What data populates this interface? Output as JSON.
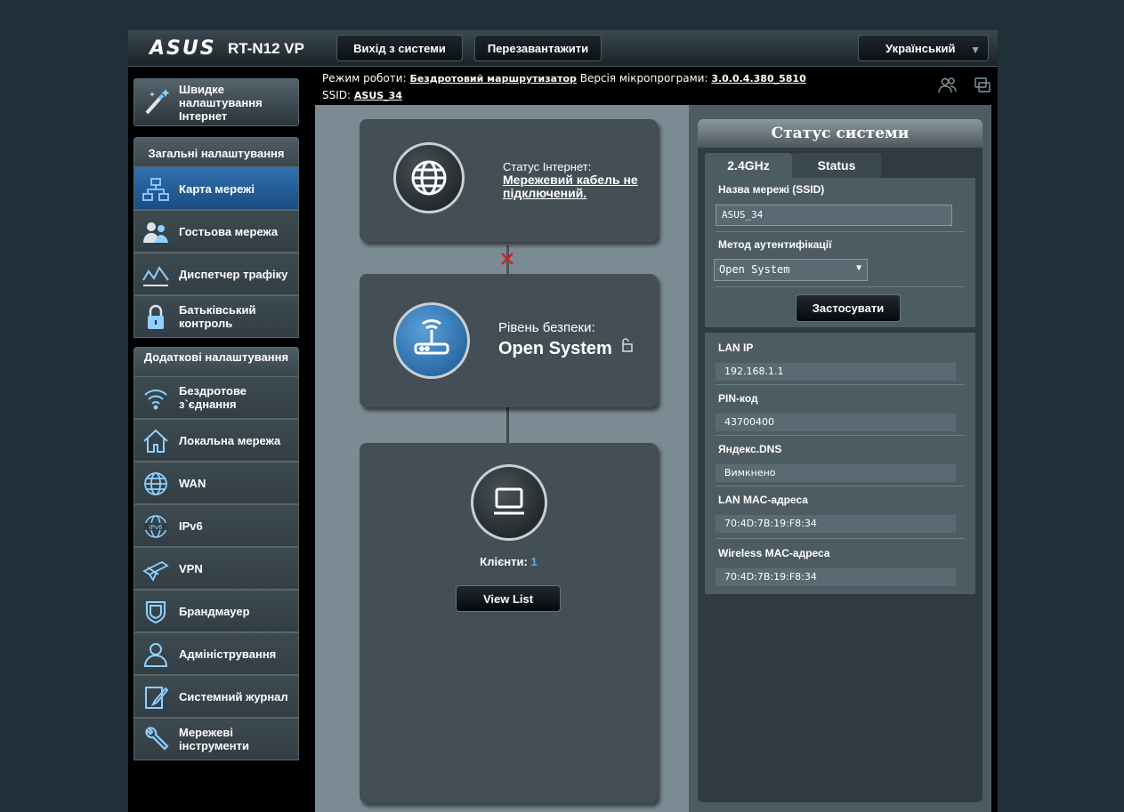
{
  "header": {
    "logo_text": "ASUS",
    "model": "RT-N12 VP",
    "logout_label": "Вихід з системи",
    "reboot_label": "Перезавантажити",
    "language": "Український"
  },
  "info": {
    "mode_label": "Режим роботи:",
    "mode_value": "Бездротовий маршрутизатор",
    "fw_label": "Версія мікропрограми:",
    "fw_value": "3.0.0.4.380_5810",
    "ssid_label": "SSID:",
    "ssid_value": "ASUS_34"
  },
  "sidebar": {
    "quick_setup": "Швидке налаштування Інтернет",
    "general_header": "Загальні налаштування",
    "general_items": [
      {
        "label": "Карта мережі",
        "icon": "network-map-icon",
        "active": true
      },
      {
        "label": "Гостьова мережа",
        "icon": "guest-network-icon"
      },
      {
        "label": "Диспетчер трафіку",
        "icon": "traffic-manager-icon"
      },
      {
        "label": "Батьківський контроль",
        "icon": "parental-lock-icon"
      }
    ],
    "advanced_header": "Додаткові налаштування",
    "advanced_items": [
      {
        "label": "Бездротове з`єднання",
        "icon": "wifi-icon"
      },
      {
        "label": "Локальна мережа",
        "icon": "home-icon"
      },
      {
        "label": "WAN",
        "icon": "globe-icon"
      },
      {
        "label": "IPv6",
        "icon": "ipv6-icon"
      },
      {
        "label": "VPN",
        "icon": "vpn-icon"
      },
      {
        "label": "Брандмауер",
        "icon": "shield-icon"
      },
      {
        "label": "Адміністрування",
        "icon": "user-icon"
      },
      {
        "label": "Системний журнал",
        "icon": "log-icon"
      },
      {
        "label": "Мережеві інструменти",
        "icon": "tools-icon"
      }
    ]
  },
  "map": {
    "internet_status_label": "Статус Інтернет:",
    "internet_status_value": "Мережевий кабель не підключений.",
    "security_label": "Рівень безпеки:",
    "security_value": "Open System",
    "clients_label": "Клієнти:",
    "clients_count": "1",
    "view_list_label": "View List"
  },
  "status": {
    "title": "Статус системи",
    "tabs": [
      "2.4GHz",
      "Status"
    ],
    "ssid_label": "Назва мережі (SSID)",
    "ssid_value": "ASUS_34",
    "auth_label": "Метод аутентифікації",
    "auth_value": "Open System",
    "apply_label": "Застосувати",
    "fields": [
      {
        "label": "LAN IP",
        "value": "192.168.1.1"
      },
      {
        "label": "PIN-код",
        "value": "43700400"
      },
      {
        "label": "Яндекс.DNS",
        "value": "Вимкнено"
      },
      {
        "label": "LAN MAC-адреса",
        "value": "70:4D:7B:19:F8:34"
      },
      {
        "label": "Wireless MAC-адреса",
        "value": "70:4D:7B:19:F8:34"
      }
    ]
  },
  "colors": {
    "accent": "#1f5fa0",
    "link_blue": "#5fa8e8",
    "disconnected_red": "#c0282c"
  }
}
